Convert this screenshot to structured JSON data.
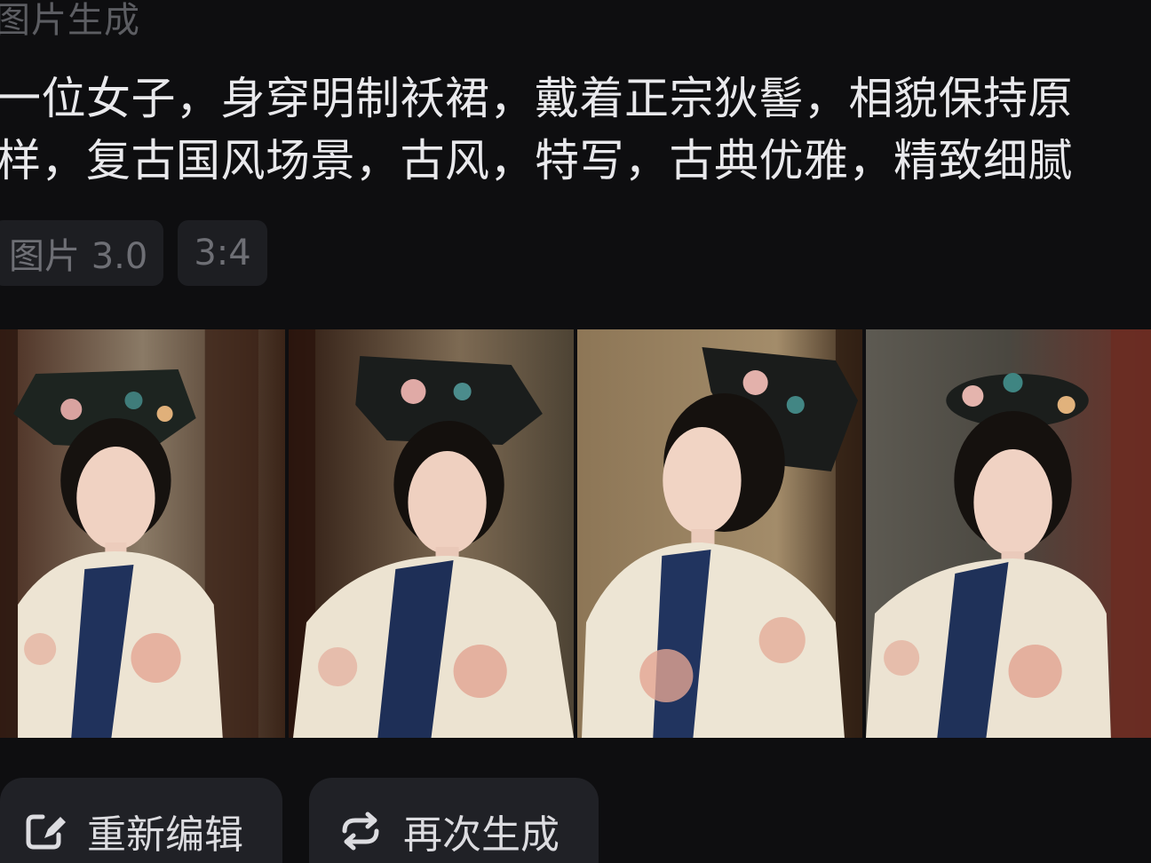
{
  "section": {
    "title": "图片生成"
  },
  "prompt": {
    "line1": "一位女子，身穿明制袄裙，戴着正宗狄髻，相貌保持原",
    "line2": "样，复古国风场景，古风，特写，古典优雅，精致细腻"
  },
  "tags": [
    {
      "label": "图片 3.0"
    },
    {
      "label": "3:4"
    }
  ],
  "images": [
    {
      "icon": "portrait-image"
    },
    {
      "icon": "portrait-image"
    },
    {
      "icon": "portrait-image"
    },
    {
      "icon": "portrait-image"
    }
  ],
  "actions": {
    "edit": {
      "label": "重新编辑",
      "icon": "edit-icon"
    },
    "regenerate": {
      "label": "再次生成",
      "icon": "refresh-icon"
    }
  }
}
